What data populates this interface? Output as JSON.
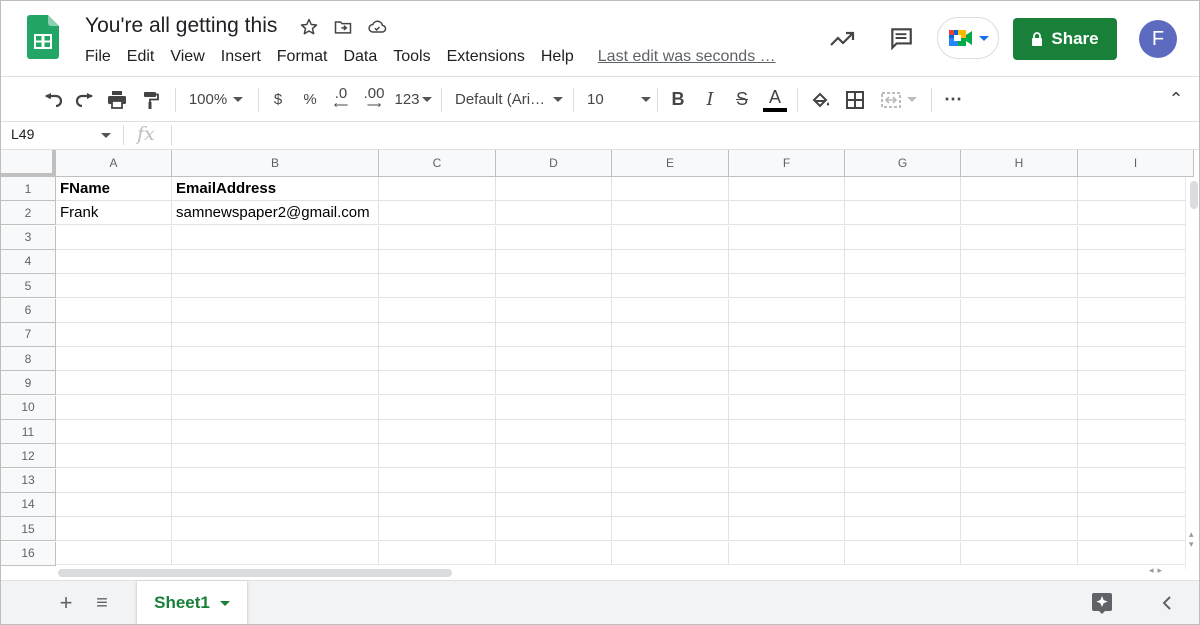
{
  "header": {
    "doc_title": "You're all getting this",
    "menu": [
      "File",
      "Edit",
      "View",
      "Insert",
      "Format",
      "Data",
      "Tools",
      "Extensions",
      "Help"
    ],
    "last_edit": "Last edit was seconds …",
    "share_label": "Share",
    "avatar_initial": "F",
    "icons": [
      "star-icon",
      "move-to-folder-icon",
      "cloud-status-icon",
      "activity-trend-icon",
      "comments-icon",
      "google-meet-icon",
      "lock-icon"
    ]
  },
  "toolbar": {
    "zoom": "100%",
    "currency": "$",
    "percent": "%",
    "decrease_decimal": ".0",
    "increase_decimal": ".00",
    "more_formats": "123",
    "font": "Default (Ari…",
    "font_size": "10",
    "bold": "B",
    "italic": "I",
    "strikethrough": "S",
    "text_color_letter": "A",
    "more": "⋯",
    "collapse": "⌃"
  },
  "formula_bar": {
    "name_box": "L49",
    "fx": "fx",
    "formula": ""
  },
  "grid": {
    "columns": [
      "A",
      "B",
      "C",
      "D",
      "E",
      "F",
      "G",
      "H",
      "I"
    ],
    "rows": [
      "1",
      "2",
      "3",
      "4",
      "5",
      "6",
      "7",
      "8",
      "9",
      "10",
      "11",
      "12",
      "13",
      "14",
      "15",
      "16"
    ],
    "cells": {
      "A1": "FName",
      "B1": "EmailAddress",
      "A2": "Frank",
      "B2": "samnewspaper2@gmail.com"
    }
  },
  "sheets": {
    "add": "+",
    "all_sheets": "≡",
    "tabs": [
      "Sheet1"
    ]
  },
  "colors": {
    "brand_green": "#188038",
    "avatar": "#5c6bc0"
  }
}
